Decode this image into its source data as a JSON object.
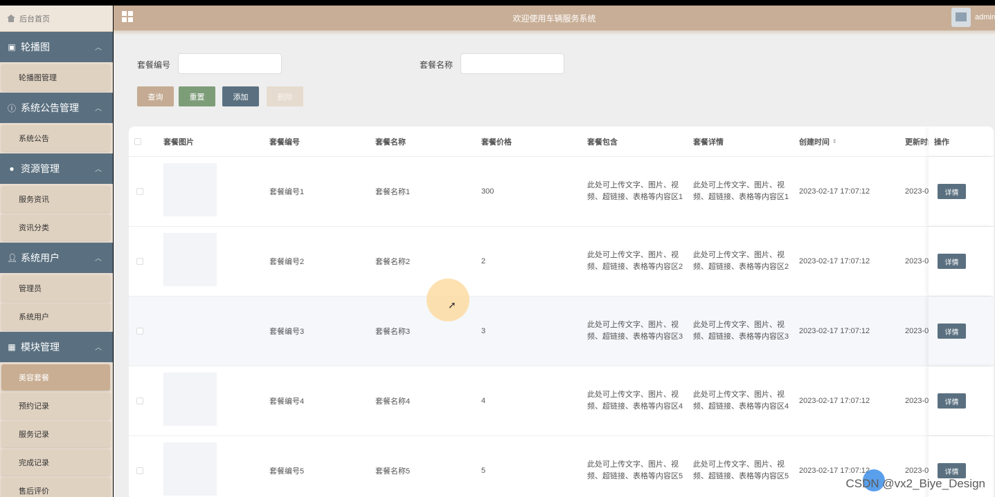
{
  "sidebar": {
    "home": "后台首页",
    "groups": [
      {
        "label": "轮播图",
        "icon": "image-icon",
        "items": [
          {
            "label": "轮播图管理"
          }
        ]
      },
      {
        "label": "系统公告管理",
        "icon": "info-icon",
        "items": [
          {
            "label": "系统公告"
          }
        ]
      },
      {
        "label": "资源管理",
        "icon": "bulb-icon",
        "items": [
          {
            "label": "服务资讯"
          },
          {
            "label": "资讯分类"
          }
        ]
      },
      {
        "label": "系统用户",
        "icon": "user-icon",
        "items": [
          {
            "label": "管理员"
          },
          {
            "label": "系统用户"
          }
        ]
      },
      {
        "label": "模块管理",
        "icon": "grid-icon",
        "items": [
          {
            "label": "美容套餐"
          },
          {
            "label": "预约记录"
          },
          {
            "label": "服务记录"
          },
          {
            "label": "完成记录"
          },
          {
            "label": "售后评价"
          }
        ]
      }
    ]
  },
  "header": {
    "title": "欢迎使用车辆服务系统",
    "user": "admin"
  },
  "search": {
    "code_label": "套餐编号",
    "code_value": "",
    "name_label": "套餐名称",
    "name_value": ""
  },
  "buttons": {
    "query": "查询",
    "reset": "重置",
    "add": "添加",
    "delete": "删除"
  },
  "table": {
    "columns": [
      "套餐图片",
      "套餐编号",
      "套餐名称",
      "套餐价格",
      "套餐包含",
      "套餐详情",
      "创建时间",
      "更新时间",
      "操作"
    ],
    "detail_label": "详情",
    "rows": [
      {
        "code": "套餐编号1",
        "name": "套餐名称1",
        "price": "300",
        "include": "此处可上传文字、图片、视频、超链接、表格等内容区1",
        "detail": "此处可上传文字、图片、视频、超链接、表格等内容区1",
        "created": "2023-02-17 17:07:12",
        "updated": "2023-0"
      },
      {
        "code": "套餐编号2",
        "name": "套餐名称2",
        "price": "2",
        "include": "此处可上传文字、图片、视频、超链接、表格等内容区2",
        "detail": "此处可上传文字、图片、视频、超链接、表格等内容区2",
        "created": "2023-02-17 17:07:12",
        "updated": "2023-0"
      },
      {
        "code": "套餐编号3",
        "name": "套餐名称3",
        "price": "3",
        "include": "此处可上传文字、图片、视频、超链接、表格等内容区3",
        "detail": "此处可上传文字、图片、视频、超链接、表格等内容区3",
        "created": "2023-02-17 17:07:12",
        "updated": "2023-0"
      },
      {
        "code": "套餐编号4",
        "name": "套餐名称4",
        "price": "4",
        "include": "此处可上传文字、图片、视频、超链接、表格等内容区4",
        "detail": "此处可上传文字、图片、视频、超链接、表格等内容区4",
        "created": "2023-02-17 17:07:12",
        "updated": "2023-0"
      },
      {
        "code": "套餐编号5",
        "name": "套餐名称5",
        "price": "5",
        "include": "此处可上传文字、图片、视频、超链接、表格等内容区5",
        "detail": "此处可上传文字、图片、视频、超链接、表格等内容区5",
        "created": "2023-02-17 17:07:12",
        "updated": "2023-0"
      }
    ]
  },
  "watermark": "CSDN @vx2_Biye_Design"
}
